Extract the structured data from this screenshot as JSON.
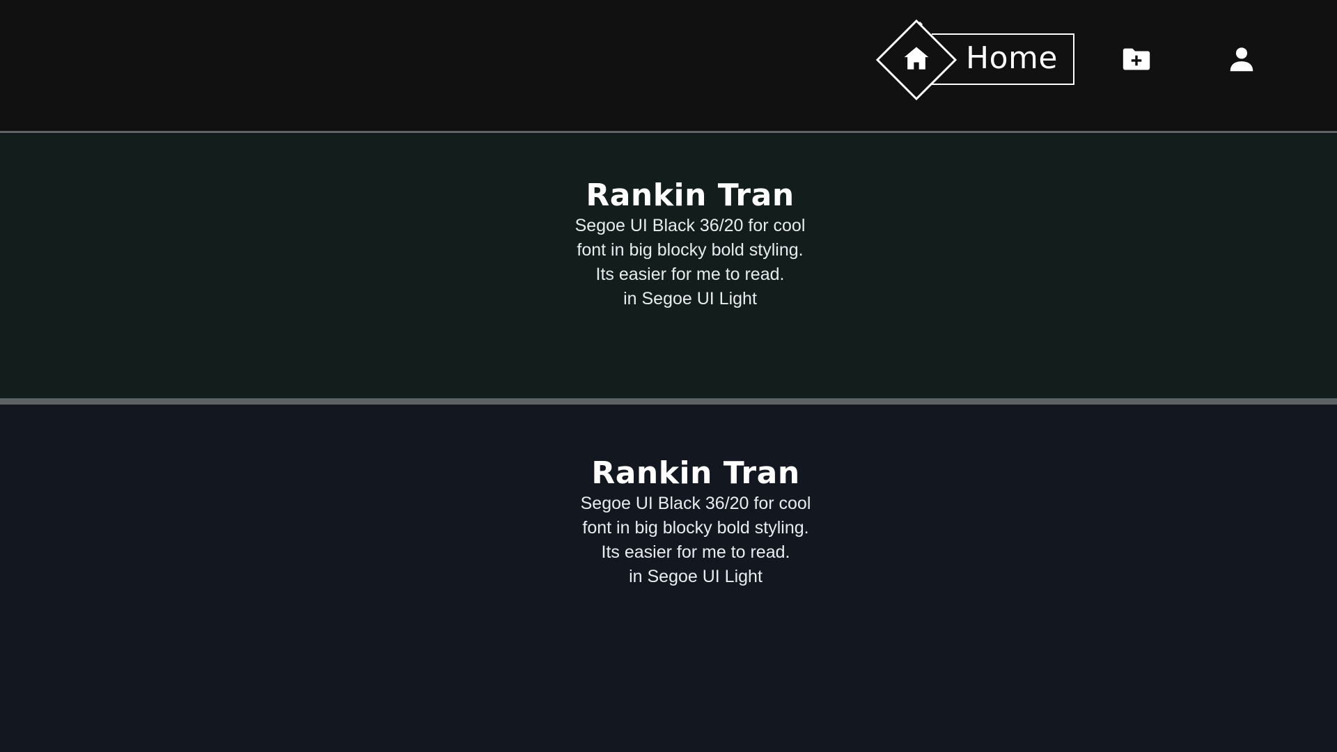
{
  "nav": {
    "home_label": "Home",
    "icons": {
      "home": "home-icon",
      "folder_add": "folder-add-icon",
      "user": "user-icon"
    }
  },
  "sections": [
    {
      "title": "Rankin Tran",
      "lines": [
        "Segoe UI Black 36/20 for cool",
        "font in big blocky bold styling.",
        "Its easier for me to read.",
        "in Segoe UI Light"
      ]
    },
    {
      "title": "Rankin Tran",
      "lines": [
        "Segoe UI Black 36/20 for cool",
        "font in big blocky bold styling.",
        "Its easier for me to read.",
        "in Segoe UI Light"
      ]
    }
  ],
  "colors": {
    "header_bg": "#111111",
    "section_green_bg": "#121d1c",
    "section_navy_bg": "#131820",
    "divider": "#5e6265",
    "text": "#ffffff"
  }
}
